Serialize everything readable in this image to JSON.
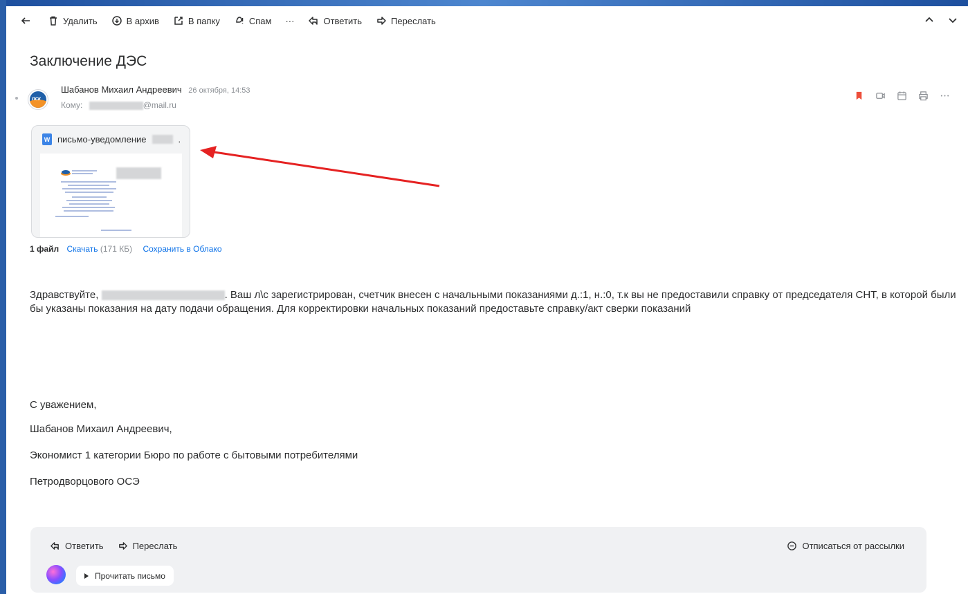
{
  "toolbar": {
    "delete_label": "Удалить",
    "archive_label": "В архив",
    "folder_label": "В папку",
    "spam_label": "Спам",
    "more_label": "···",
    "reply_label": "Ответить",
    "forward_label": "Переслать"
  },
  "email": {
    "subject": "Заключение ДЭС",
    "avatar_text": "пск",
    "sender_name": "Шабанов Михаил Андреевич",
    "date": "26 октября, 14:53",
    "to_label": "Кому:",
    "to_domain": "@mail.ru"
  },
  "attachment": {
    "filename": "письмо-уведомление",
    "file_suffix": ".",
    "icon_letter": "W",
    "files_count": "1 файл",
    "download_label": "Скачать",
    "size": "(171 КБ)",
    "save_cloud_label": "Сохранить в Облако"
  },
  "body": {
    "greeting": "Здравствуйте,",
    "text": ". Ваш л\\с зарегистрирован, счетчик внесен с начальными показаниями д.:1, н.:0, т.к вы не предоставили справку от председателя СНТ, в которой были бы указаны показания на дату подачи обращения. Для корректировки начальных показаний предоставьте справку/акт сверки показаний"
  },
  "signature": {
    "regards": "С уважением,",
    "name": "Шабанов Михаил Андреевич,",
    "position": "Экономист 1 категории Бюро по работе с бытовыми потребителями",
    "department": "Петродворцового ОСЭ"
  },
  "reply_panel": {
    "reply_label": "Ответить",
    "forward_label": "Переслать",
    "unsubscribe_label": "Отписаться от рассылки",
    "read_label": "Прочитать письмо"
  },
  "colors": {
    "link": "#0d72e8",
    "bookmark": "#ed4e3a",
    "arrow": "#e52222"
  }
}
